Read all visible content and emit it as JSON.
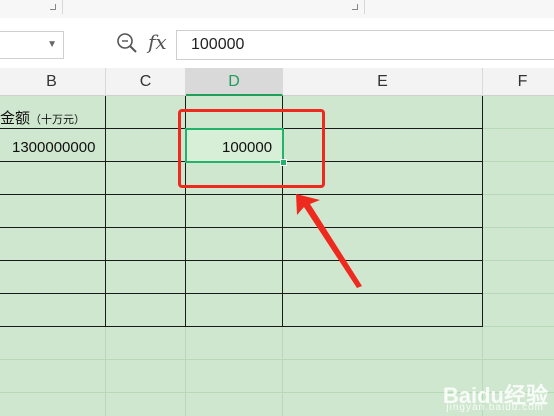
{
  "formula_bar": {
    "name_box_value": "",
    "zoom_icon": "zoom-icon",
    "fx_label": "fx",
    "formula_value": "100000"
  },
  "columns": [
    {
      "label": "B",
      "active": false
    },
    {
      "label": "C",
      "active": false
    },
    {
      "label": "D",
      "active": true
    },
    {
      "label": "E",
      "active": false
    },
    {
      "label": "F",
      "active": false
    }
  ],
  "cells": {
    "b1_main": "金额",
    "b1_unit": "（十万元）",
    "b2": "1300000000",
    "d2": "100000"
  },
  "annotation": {
    "highlight_color": "#ee2a1f",
    "selection_color": "#23b26a"
  },
  "watermark": {
    "text": "Baidu经验",
    "sub": "jingyan.baidu.com"
  }
}
